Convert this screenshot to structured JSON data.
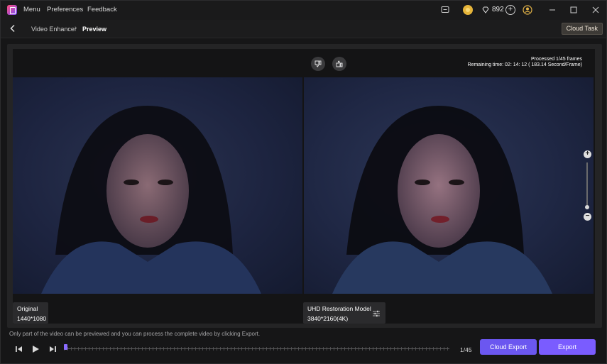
{
  "titlebar": {
    "menu": [
      "Menu",
      "Preferences",
      "Feedback"
    ],
    "gem_count": "892",
    "icons": [
      "app-logo",
      "chat-icon",
      "coin-icon",
      "gem-icon",
      "plus-icon",
      "user-icon"
    ],
    "window_controls": [
      "minimize",
      "maximize",
      "close"
    ]
  },
  "nav": {
    "parent": "Video Enhancer",
    "separator": "›",
    "current": "Preview",
    "cloud_task_label": "Cloud Task"
  },
  "preview": {
    "processed": "Processed 1/45 frames",
    "remaining": "Remaining time: 02: 14: 12 ( 183.14 Second/Frame)",
    "left": {
      "title": "Original",
      "resolution": "1440*1080"
    },
    "right": {
      "title": "UHD Restoration Model",
      "resolution": "3840*2160(4K)"
    },
    "zoom_level": 0.0
  },
  "footer": {
    "notice": "Only part of the video can be previewed and you can process the complete video by clicking Export.",
    "frame_counter": "1/45",
    "playhead_fraction": 0.0,
    "cloud_export_label": "Cloud Export",
    "export_label": "Export"
  },
  "colors": {
    "accent": "#7a5cff",
    "cloud_task_bg": "#3d3a36"
  }
}
